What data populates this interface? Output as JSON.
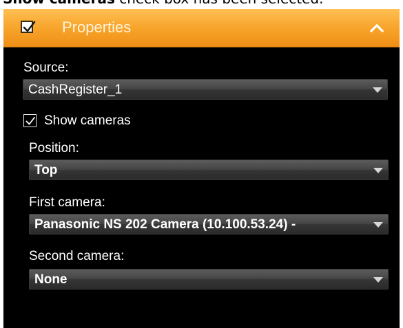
{
  "caption": {
    "bold_text": "Show cameras",
    "rest_text": " check box has been selected."
  },
  "panel": {
    "title": "Properties",
    "header_checked": true,
    "collapse_icon": "chevron-up-icon"
  },
  "source": {
    "label": "Source:",
    "value": "CashRegister_1"
  },
  "show_cameras": {
    "label": "Show cameras",
    "checked": true
  },
  "position": {
    "label": "Position:",
    "value": "Top"
  },
  "first_camera": {
    "label": "First camera:",
    "value": "Panasonic NS 202 Camera (10.100.53.24) -"
  },
  "second_camera": {
    "label": "Second camera:",
    "value": "None"
  },
  "colors": {
    "header_orange": "#f7a229",
    "panel_background": "#000000",
    "text": "#ffffff"
  }
}
